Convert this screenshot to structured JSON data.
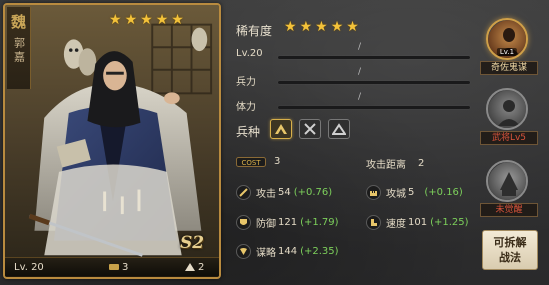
{
  "card": {
    "faction": "魏",
    "name": "郭嘉",
    "stars": 5,
    "level_text": "Lv. 20",
    "troops": "3",
    "cost": "2",
    "season_badge": "S2"
  },
  "info": {
    "rarity_label": "稀有度",
    "rarity_stars": 5,
    "level_label": "Lv.20",
    "soldiers_label": "兵力",
    "stamina_label": "体力",
    "slash": "/",
    "troop_type_label": "兵种",
    "troop_types": [
      {
        "icon": "cavalry-icon",
        "active": true
      },
      {
        "icon": "crossed-spears-icon",
        "active": false
      },
      {
        "icon": "archer-tent-icon",
        "active": false
      }
    ],
    "cost_label": "COST",
    "cost_value": "3",
    "range_label": "攻击距离",
    "range_value": "2"
  },
  "attributes": {
    "attack": {
      "label": "攻击",
      "value": "54",
      "bonus": "(+0.76)"
    },
    "siege": {
      "label": "攻城",
      "value": "5",
      "bonus": "(+0.16)"
    },
    "defense": {
      "label": "防御",
      "value": "121",
      "bonus": "(+1.79)"
    },
    "speed": {
      "label": "速度",
      "value": "101",
      "bonus": "(+1.25)"
    },
    "intellect": {
      "label": "谋略",
      "value": "144",
      "bonus": "(+2.35)"
    }
  },
  "skills": [
    {
      "label": "奇佐鬼谋",
      "level": "Lv.1",
      "icon": "strategist-skill-icon"
    },
    {
      "label": "武将Lv5",
      "icon": "locked-skill-icon"
    },
    {
      "label": "未觉醒",
      "icon": "unawakened-skill-icon"
    }
  ],
  "split_button": {
    "line1": "可拆解",
    "line2": "战法"
  },
  "colors": {
    "gold": "#c8a24a",
    "star": "#f3c23a",
    "bonus_green": "#7ccf5b",
    "locked_red": "#d9533b"
  }
}
